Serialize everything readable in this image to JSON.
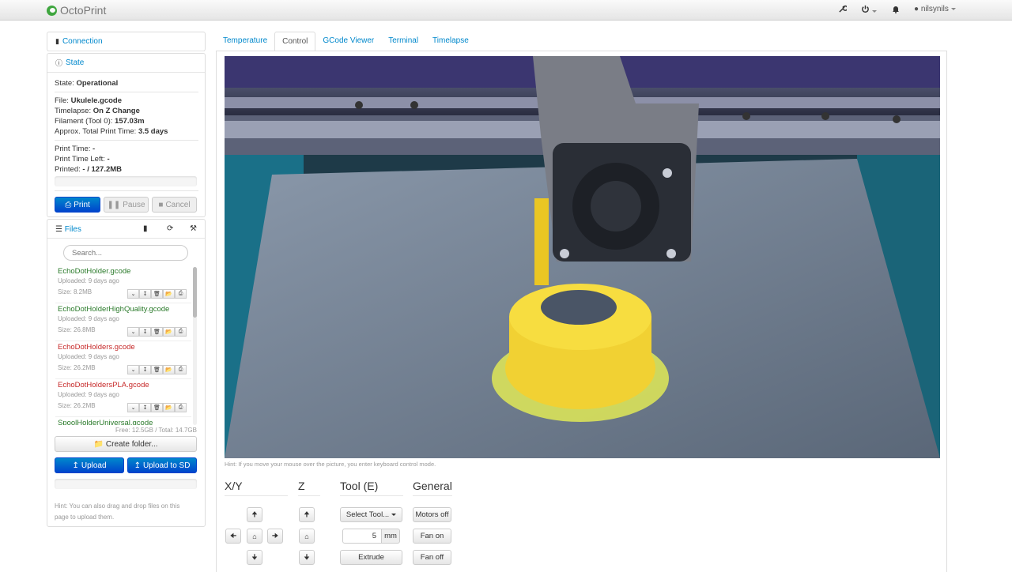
{
  "navbar": {
    "brand": "OctoPrint",
    "user": "nilsynils"
  },
  "connection": {
    "title": "Connection"
  },
  "state": {
    "title": "State",
    "state_label": "State:",
    "state_value": "Operational",
    "file_label": "File:",
    "file_value": "Ukulele.gcode",
    "timelapse_label": "Timelapse:",
    "timelapse_value": "On Z Change",
    "filament_label": "Filament (Tool 0):",
    "filament_value": "157.03m",
    "total_time_label": "Approx. Total Print Time:",
    "total_time_value": "3.5 days",
    "print_time_label": "Print Time:",
    "print_time_value": "-",
    "time_left_label": "Print Time Left:",
    "time_left_value": "-",
    "printed_label": "Printed:",
    "printed_value": "- / 127.2MB",
    "print_button": "Print",
    "pause_button": "Pause",
    "cancel_button": "Cancel"
  },
  "files": {
    "title": "Files",
    "search_placeholder": "Search...",
    "items": [
      {
        "name": "EchoDotHolder.gcode",
        "uploaded": "Uploaded: 9 days ago",
        "size": "Size: 8.2MB",
        "status": "ok"
      },
      {
        "name": "EchoDotHolderHighQuality.gcode",
        "uploaded": "Uploaded: 9 days ago",
        "size": "Size: 26.8MB",
        "status": "ok"
      },
      {
        "name": "EchoDotHolders.gcode",
        "uploaded": "Uploaded: 9 days ago",
        "size": "Size: 26.2MB",
        "status": "bad"
      },
      {
        "name": "EchoDotHoldersPLA.gcode",
        "uploaded": "Uploaded: 9 days ago",
        "size": "Size: 26.2MB",
        "status": "bad"
      },
      {
        "name": "SpoolHolderUniversal.gcode",
        "uploaded": "",
        "size": "",
        "status": "ok"
      }
    ],
    "free_space": "Free: 12.5GB / Total: 14.7GB",
    "create_folder": "Create folder...",
    "upload": "Upload",
    "upload_sd": "Upload to SD",
    "hint": "Hint: You can also drag and drop files on this page to upload them."
  },
  "tabs": [
    "Temperature",
    "Control",
    "GCode Viewer",
    "Terminal",
    "Timelapse"
  ],
  "control": {
    "hint": "Hint: If you move your mouse over the picture, you enter keyboard control mode.",
    "xy_title": "X/Y",
    "z_title": "Z",
    "tool_title": "Tool (E)",
    "general_title": "General",
    "select_tool": "Select Tool...",
    "extrude_amount": "5",
    "unit": "mm",
    "extrude": "Extrude",
    "motors_off": "Motors off",
    "fan_on": "Fan on",
    "fan_off": "Fan off"
  },
  "colors": {
    "link": "#0088cc",
    "primary": "#0055cc",
    "file_ok": "#2a7a2a",
    "file_error": "#c62828",
    "brand_green": "#3fa63f"
  }
}
